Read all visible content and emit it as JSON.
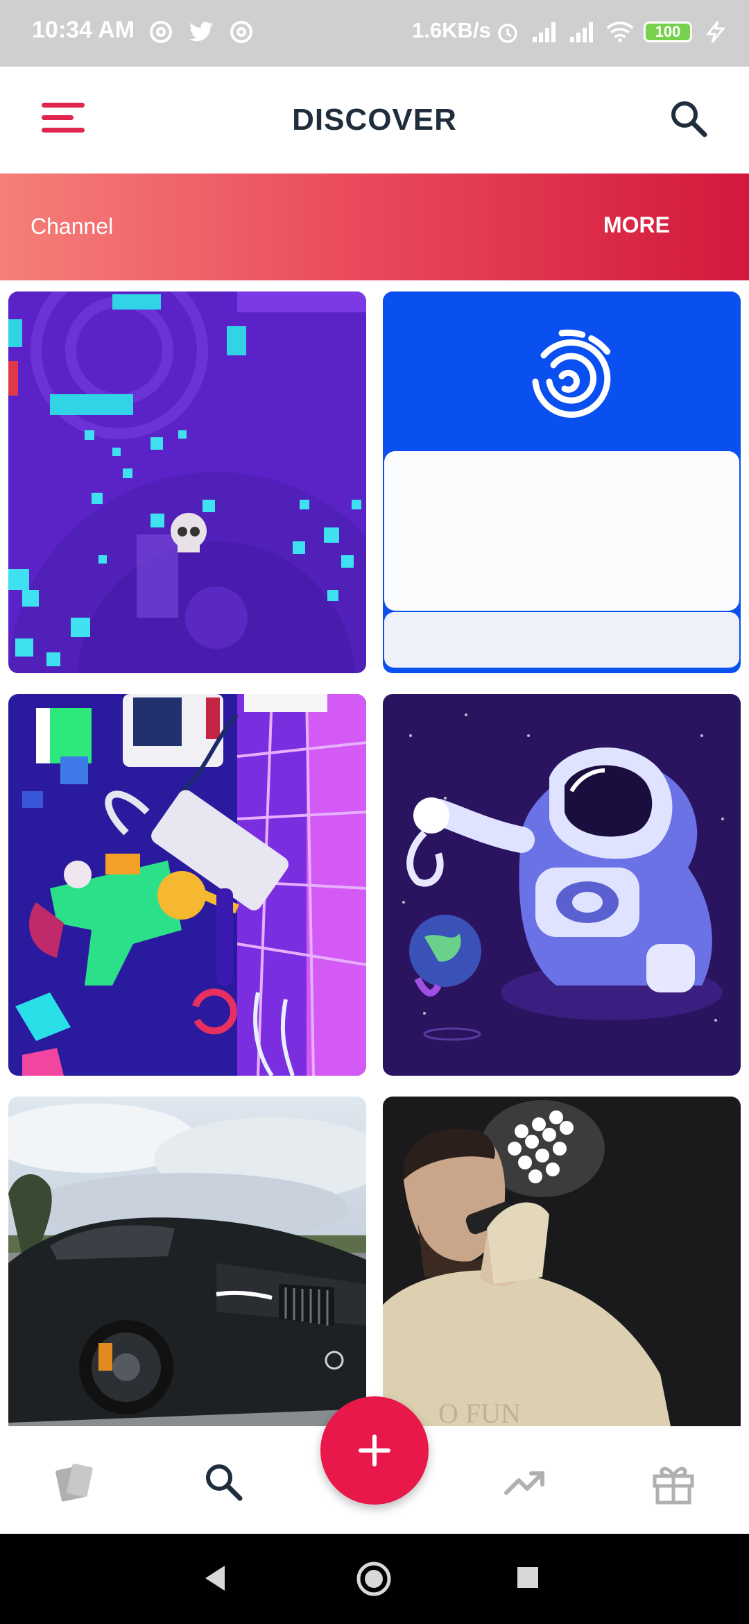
{
  "status_bar": {
    "time": "10:34 AM",
    "net_speed": "1.6KB/s",
    "battery": "100"
  },
  "header": {
    "title": "DISCOVER"
  },
  "banner": {
    "label": "Channel",
    "more": "MORE"
  },
  "colors": {
    "accent": "#e8194a",
    "title": "#1f2d3d",
    "nav_active": "#1f2d3d",
    "nav_inactive": "#b0b0b0"
  },
  "tiles": [
    {
      "id": "game-skull-neon-purple"
    },
    {
      "id": "blue-fingerprint-card"
    },
    {
      "id": "retro-gamer-illustration"
    },
    {
      "id": "astronaut-holding-earth"
    },
    {
      "id": "black-sports-car"
    },
    {
      "id": "singer-with-microphone"
    }
  ],
  "bottom_nav": {
    "items": [
      "cards-icon",
      "search-icon",
      "add-icon",
      "trending-icon",
      "gift-icon"
    ],
    "active": "search-icon"
  },
  "system_nav": [
    "back-icon",
    "home-icon",
    "recents-icon"
  ]
}
